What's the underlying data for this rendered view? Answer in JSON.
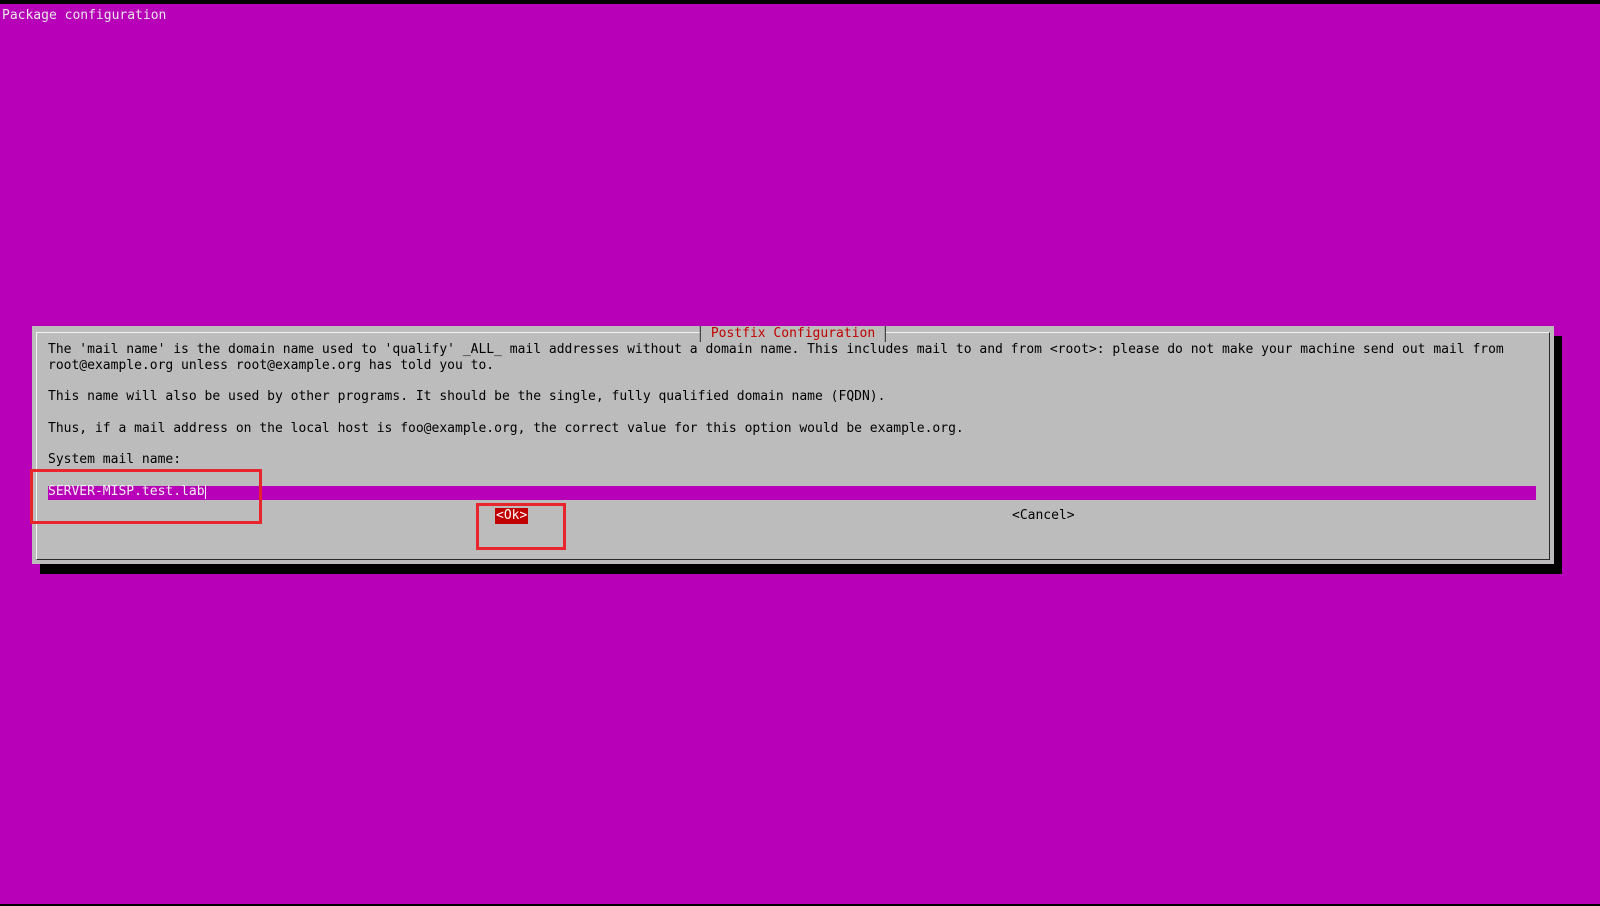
{
  "window": {
    "title": "Package configuration"
  },
  "dialog": {
    "title": "Postfix Configuration",
    "paragraph1_line1": "The 'mail name' is the domain name used to 'qualify' _ALL_ mail addresses without a domain name. This includes mail to and from <root>: please do not make your machine send out mail from",
    "paragraph1_line2": "root@example.org unless root@example.org has told you to.",
    "paragraph2": "This name will also be used by other programs. It should be the single, fully qualified domain name (FQDN).",
    "paragraph3": "Thus, if a mail address on the local host is foo@example.org, the correct value for this option would be example.org.",
    "field_label": "System mail name:",
    "field_value": "SERVER-MISP.test.lab",
    "ok_label": "<Ok>",
    "cancel_label": "<Cancel>"
  },
  "colors": {
    "background": "#b900b9",
    "dialog": "#bcbcbc",
    "title_text": "#c00000",
    "button_selected": "#c00000",
    "annotation_box": "#e8242c"
  }
}
